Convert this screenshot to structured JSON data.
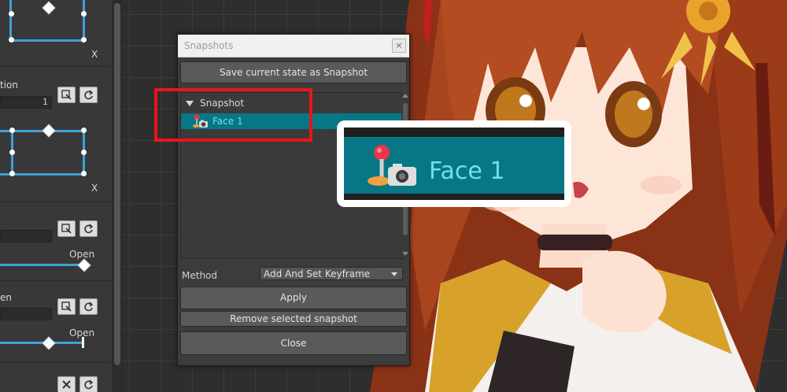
{
  "left_panel": {
    "axis_label_1": "X",
    "axis_label_2": "X",
    "section_label_1": "tion",
    "field_value_1": "1",
    "open_label_1": "Open",
    "section_label_2": "en",
    "open_label_2": "Open"
  },
  "dialog": {
    "title": "Snapshots",
    "close_glyph": "×",
    "save_button": "Save current state as Snapshot",
    "tree_root_label": "Snapshot",
    "selected_item": "Face 1",
    "method_label": "Method",
    "method_value": "Add And Set Keyframe",
    "apply_button": "Apply",
    "remove_button": "Remove selected snapshot",
    "close_button": "Close"
  },
  "zoom_callout": {
    "item_label": "Face 1"
  },
  "colors": {
    "selection_bg": "#077786",
    "selection_text": "#6fe0ea",
    "highlight_red": "#e8141c",
    "curve_blue": "#3ea0d6"
  },
  "icons": {
    "snapshot_item": "joystick-camera-icon",
    "target": "target-icon",
    "reset": "reset-icon",
    "remove": "close-icon",
    "expand": "triangle-down-icon",
    "dropdown": "chevron-down-icon"
  }
}
